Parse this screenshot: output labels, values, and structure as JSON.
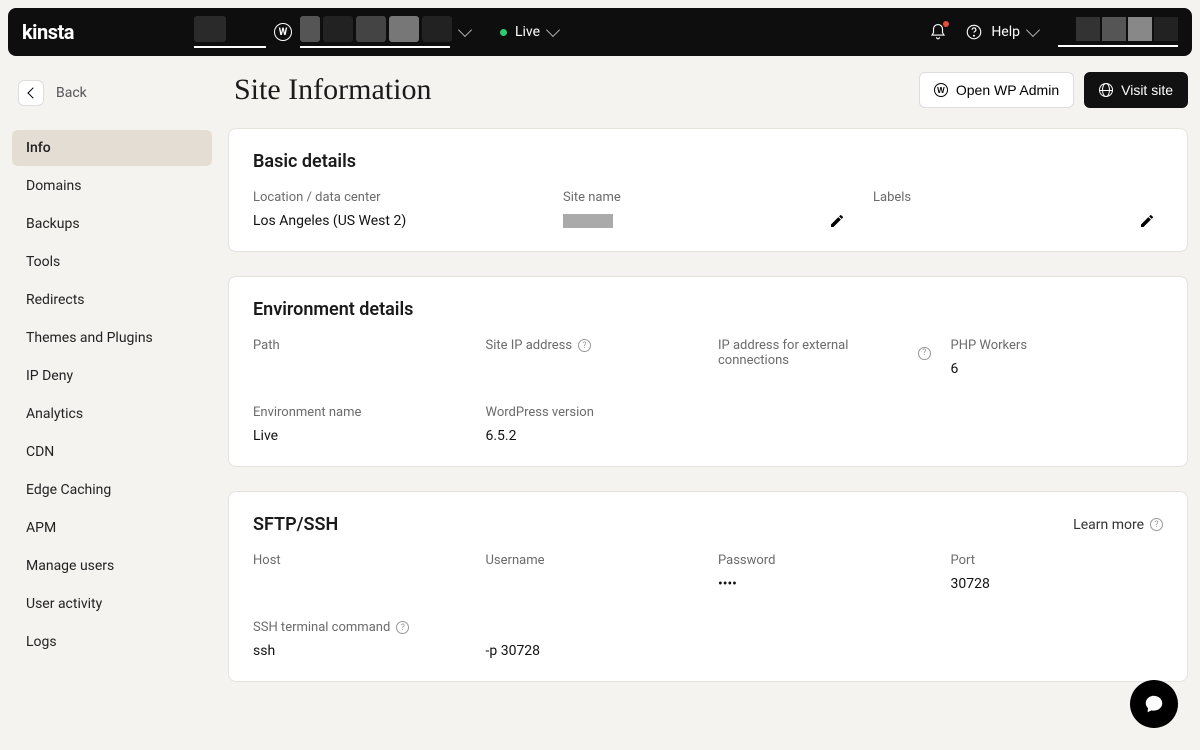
{
  "topbar": {
    "logo": "kinsta",
    "env_label": "Live",
    "help_label": "Help"
  },
  "back_label": "Back",
  "sidebar": {
    "items": [
      {
        "label": "Info",
        "active": true
      },
      {
        "label": "Domains"
      },
      {
        "label": "Backups"
      },
      {
        "label": "Tools"
      },
      {
        "label": "Redirects"
      },
      {
        "label": "Themes and Plugins"
      },
      {
        "label": "IP Deny"
      },
      {
        "label": "Analytics"
      },
      {
        "label": "CDN"
      },
      {
        "label": "Edge Caching"
      },
      {
        "label": "APM"
      },
      {
        "label": "Manage users"
      },
      {
        "label": "User activity"
      },
      {
        "label": "Logs"
      }
    ]
  },
  "page": {
    "title": "Site Information",
    "open_wp_admin": "Open WP Admin",
    "visit_site": "Visit site"
  },
  "basic": {
    "title": "Basic details",
    "location_label": "Location / data center",
    "location_value": "Los Angeles (US West 2)",
    "site_name_label": "Site name",
    "labels_label": "Labels"
  },
  "env": {
    "title": "Environment details",
    "path_label": "Path",
    "ip_label": "Site IP address",
    "ext_ip_label": "IP address for external connections",
    "workers_label": "PHP Workers",
    "workers_value": "6",
    "env_name_label": "Environment name",
    "env_name_value": "Live",
    "wp_ver_label": "WordPress version",
    "wp_ver_value": "6.5.2"
  },
  "sftp": {
    "title": "SFTP/SSH",
    "learn_more": "Learn more",
    "host_label": "Host",
    "user_label": "Username",
    "pass_label": "Password",
    "pass_value": "••••",
    "port_label": "Port",
    "port_value": "30728",
    "ssh_cmd_label": "SSH terminal command",
    "ssh_cmd_1": "ssh",
    "ssh_cmd_2": "-p 30728"
  }
}
